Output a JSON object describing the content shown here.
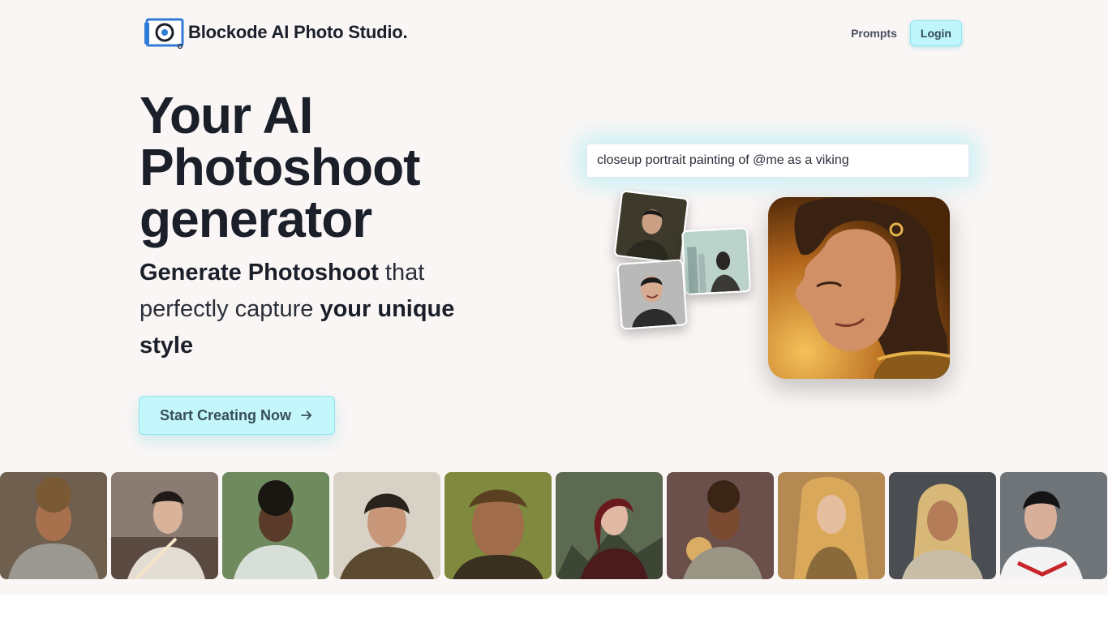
{
  "header": {
    "brand_name": "Blockode AI Photo Studio.",
    "nav": {
      "prompts_label": "Prompts",
      "login_label": "Login"
    }
  },
  "hero": {
    "title": "Your AI Photoshoot generator",
    "subtitle_parts": {
      "a": "Generate Photoshoot",
      "b": " that perfectly capture ",
      "c": "your unique style"
    },
    "cta_label": "Start Creating Now"
  },
  "demo": {
    "prompt_text": "closeup portrait painting of @me as a viking"
  },
  "colors": {
    "accent": "#c4f7fb",
    "accent_border": "#8ee4ec",
    "background": "#faf6f5",
    "text": "#1b1f2a"
  },
  "icons": {
    "logo": "camera-lens-logo-icon",
    "cta": "arrow-right-icon"
  }
}
